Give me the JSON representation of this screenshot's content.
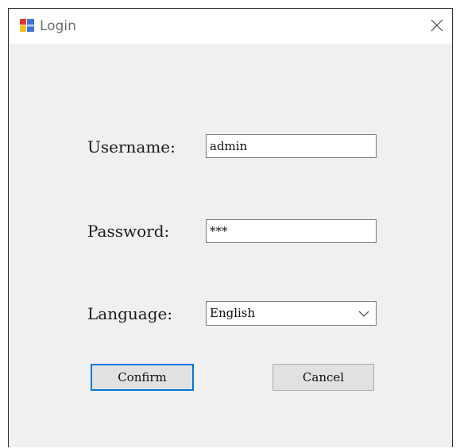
{
  "window": {
    "title": "Login",
    "app_icon": "winforms-app-icon",
    "close_icon": "close-icon"
  },
  "form": {
    "username": {
      "label": "Username:",
      "value": "admin"
    },
    "password": {
      "label": "Password:",
      "value": "***"
    },
    "language": {
      "label": "Language:",
      "selected": "English",
      "icon": "chevron-down-icon"
    }
  },
  "buttons": {
    "confirm_label": "Confirm",
    "cancel_label": "Cancel"
  },
  "colors": {
    "focus_border": "#0078d7",
    "button_face": "#e1e1e1",
    "client_background": "#f0f0f0"
  }
}
